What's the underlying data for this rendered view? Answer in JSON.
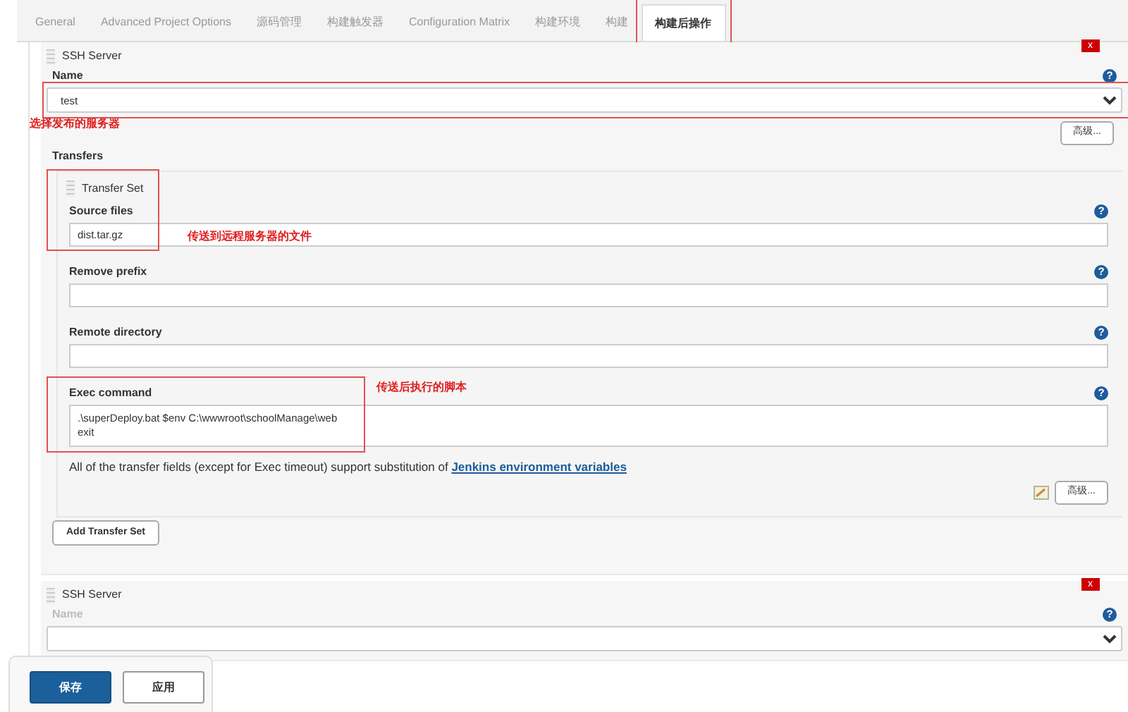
{
  "tabs": [
    {
      "label": "General",
      "selected": false,
      "highlighted": false
    },
    {
      "label": "Advanced Project Options",
      "selected": false,
      "highlighted": false
    },
    {
      "label": "源码管理",
      "selected": false,
      "highlighted": false
    },
    {
      "label": "构建触发器",
      "selected": false,
      "highlighted": false
    },
    {
      "label": "Configuration Matrix",
      "selected": false,
      "highlighted": false
    },
    {
      "label": "构建环境",
      "selected": false,
      "highlighted": false
    },
    {
      "label": "构建",
      "selected": false,
      "highlighted": false
    },
    {
      "label": "构建后操作",
      "selected": true,
      "highlighted": true
    }
  ],
  "servers": [
    {
      "title": "SSH Server",
      "remove": "x",
      "name_label": "Name",
      "name_help": "?",
      "name_value": "test",
      "name_highlighted": true,
      "annotation": "选择发布的服务器",
      "advanced": "高级...",
      "transfers_label": "Transfers",
      "transfer_sets": [
        {
          "title": "Transfer Set",
          "fields": [
            {
              "kind": "input",
              "label": "Source files",
              "help": "?",
              "value": "dist.tar.gz",
              "highlighted": true,
              "annotation": "传送到远程服务器的文件"
            },
            {
              "kind": "input",
              "label": "Remove prefix",
              "help": "?",
              "highlighted": false
            },
            {
              "kind": "input",
              "label": "Remote directory",
              "help": "?",
              "highlighted": false
            },
            {
              "kind": "textarea",
              "label": "Exec command",
              "help": "?",
              "value": ".\\superDeploy.bat $env C:\\wwwroot\\schoolManage\\web\nexit",
              "highlighted": true,
              "annotation": "传送后执行的脚本"
            }
          ],
          "note": "All of the transfer fields (except for Exec timeout) support substitution of ",
          "note_link": "Jenkins environment variables",
          "advanced": "高级..."
        }
      ],
      "add_button": "Add Transfer Set"
    },
    {
      "title": "SSH Server",
      "remove": "x",
      "name_label": "Name",
      "name_help": "?",
      "name_highlighted": false
    }
  ],
  "bottom_bar": {
    "buttons": [
      {
        "label": "保存",
        "kind": "primary"
      },
      {
        "label": "应用",
        "kind": "secondary"
      }
    ]
  }
}
